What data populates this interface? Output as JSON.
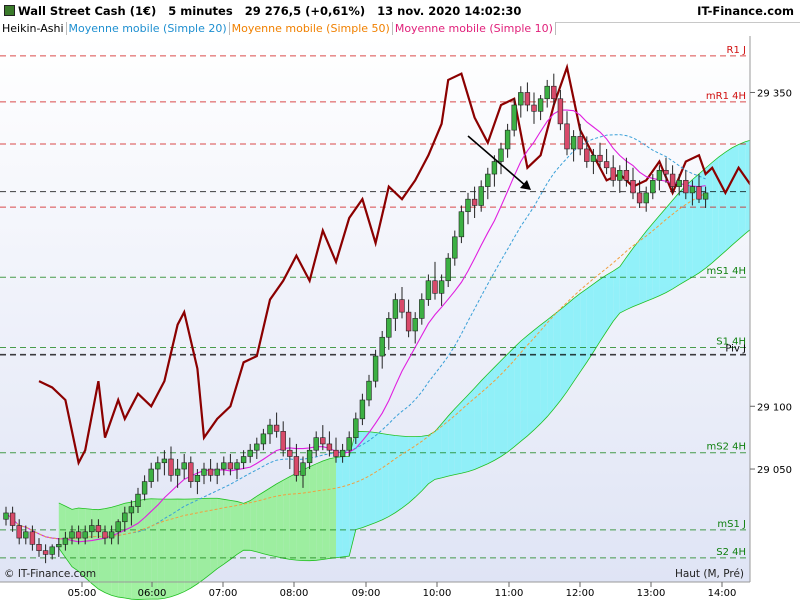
{
  "header": {
    "instrument": "Wall Street Cash (1€)",
    "timeframe": "5 minutes",
    "price": "29 276,5 (+0,61%)",
    "datetime": "13 nov. 2020 14:02:30",
    "brand": "IT-Finance.com"
  },
  "legend": {
    "chart_style": "Heikin-Ashi",
    "ma20": "Moyenne mobile (Simple 20)",
    "ma50": "Moyenne mobile (Simple 50)",
    "ma10": "Moyenne mobile (Simple 10)"
  },
  "footer": {
    "copyright": "© IT-Finance.com",
    "mode": "Haut (M, Pré)"
  },
  "colors": {
    "bull": "#3cb043",
    "bear": "#d84a6a",
    "ma20": "#3aa0d8",
    "ma50": "#f0a040",
    "ma10": "#e020e0",
    "pivot_line": "#8b0000",
    "cloud_bull": "#90ee90",
    "cloud_bear": "#80f0f8",
    "level_red": "#d01010",
    "level_green": "#108010"
  },
  "chart_data": {
    "type": "candlestick",
    "ylim": [
      28960,
      29395
    ],
    "xlim": [
      "04:20",
      "14:25"
    ],
    "x_ticks": [
      "05:00",
      "06:00",
      "07:00",
      "08:00",
      "09:00",
      "10:00",
      "11:00",
      "12:00",
      "13:00",
      "14:00"
    ],
    "y_ticks": [
      29350,
      29100,
      29050
    ],
    "levels": [
      {
        "label": "R1 J",
        "value": 29379.2,
        "value_label": "29 379,2",
        "kind": "resistance"
      },
      {
        "label": "mR1 4H",
        "value": 29342.5,
        "value_label": "29 342,5",
        "kind": "resistance"
      },
      {
        "label": "",
        "value": 29309.0,
        "value_label": "29 309,0",
        "kind": "resistance"
      },
      {
        "label": "",
        "value": 29271.0,
        "value_label": "29 271,0",
        "kind": "last"
      },
      {
        "label": "",
        "value": 29258.7,
        "value_label": "29 258,7",
        "kind": "resistance"
      },
      {
        "label": "mS1 4H",
        "value": 29202.8,
        "value_label": "29 202,8",
        "kind": "support"
      },
      {
        "label": "S1 4H",
        "value": 29146.8,
        "value_label": "29 146,8",
        "kind": "support"
      },
      {
        "label": "Piv J",
        "value": 29141.1,
        "value_label": "29 141,1",
        "kind": "pivot"
      },
      {
        "label": "mS2 4H",
        "value": 29063.0,
        "value_label": "29 063,0",
        "kind": "support"
      },
      {
        "label": "mS1 J",
        "value": 29001.5,
        "value_label": "29 001,5",
        "kind": "support"
      },
      {
        "label": "S2 4H",
        "value": 28979.2,
        "value_label": "28 979,2",
        "kind": "support"
      }
    ],
    "pivot_curve": [
      [
        5,
        29120
      ],
      [
        7,
        29115
      ],
      [
        9,
        29105
      ],
      [
        10,
        29080
      ],
      [
        11,
        29055
      ],
      [
        12,
        29065
      ],
      [
        14,
        29120
      ],
      [
        15,
        29075
      ],
      [
        17,
        29105
      ],
      [
        18,
        29090
      ],
      [
        20,
        29110
      ],
      [
        22,
        29100
      ],
      [
        24,
        29120
      ],
      [
        26,
        29165
      ],
      [
        27,
        29175
      ],
      [
        29,
        29130
      ],
      [
        30,
        29075
      ],
      [
        32,
        29090
      ],
      [
        34,
        29100
      ],
      [
        36,
        29135
      ],
      [
        38,
        29140
      ],
      [
        40,
        29185
      ],
      [
        42,
        29200
      ],
      [
        44,
        29220
      ],
      [
        46,
        29200
      ],
      [
        48,
        29240
      ],
      [
        50,
        29215
      ],
      [
        52,
        29250
      ],
      [
        54,
        29265
      ],
      [
        56,
        29230
      ],
      [
        58,
        29275
      ],
      [
        60,
        29265
      ],
      [
        62,
        29280
      ],
      [
        64,
        29300
      ],
      [
        66,
        29325
      ],
      [
        67,
        29360
      ],
      [
        69,
        29365
      ],
      [
        71,
        29330
      ],
      [
        73,
        29310
      ],
      [
        75,
        29340
      ],
      [
        77,
        29345
      ],
      [
        79,
        29290
      ],
      [
        81,
        29300
      ],
      [
        83,
        29340
      ],
      [
        85,
        29370
      ],
      [
        87,
        29320
      ],
      [
        89,
        29300
      ],
      [
        91,
        29280
      ],
      [
        93,
        29285
      ],
      [
        95,
        29275
      ],
      [
        97,
        29280
      ],
      [
        99,
        29295
      ],
      [
        101,
        29270
      ],
      [
        103,
        29295
      ],
      [
        105,
        29300
      ],
      [
        106,
        29285
      ],
      [
        107,
        29290
      ],
      [
        109,
        29270
      ],
      [
        111,
        29290
      ],
      [
        113,
        29275
      ],
      [
        115,
        29270
      ],
      [
        117,
        29260
      ],
      [
        119,
        29275
      ]
    ],
    "candles": [
      [
        0,
        29010,
        29020,
        29005,
        29015
      ],
      [
        1,
        29015,
        29020,
        29000,
        29005
      ],
      [
        2,
        29005,
        29010,
        28990,
        28995
      ],
      [
        3,
        28995,
        29005,
        28990,
        29000
      ],
      [
        4,
        29000,
        29005,
        28985,
        28990
      ],
      [
        5,
        28990,
        28995,
        28980,
        28985
      ],
      [
        6,
        28985,
        28990,
        28975,
        28982
      ],
      [
        7,
        28982,
        28990,
        28978,
        28988
      ],
      [
        8,
        28988,
        28995,
        28980,
        28990
      ],
      [
        9,
        28990,
        29000,
        28985,
        28995
      ],
      [
        10,
        28995,
        29005,
        28990,
        29000
      ],
      [
        11,
        29000,
        29005,
        28990,
        28995
      ],
      [
        12,
        28995,
        29005,
        28990,
        29000
      ],
      [
        13,
        29000,
        29010,
        28995,
        29005
      ],
      [
        14,
        29005,
        29010,
        28995,
        29000
      ],
      [
        15,
        29000,
        29005,
        28990,
        28995
      ],
      [
        16,
        28995,
        29005,
        28990,
        29000
      ],
      [
        17,
        29000,
        29010,
        28990,
        29008
      ],
      [
        18,
        29008,
        29020,
        29000,
        29015
      ],
      [
        19,
        29015,
        29025,
        29005,
        29020
      ],
      [
        20,
        29020,
        29035,
        29015,
        29030
      ],
      [
        21,
        29030,
        29045,
        29025,
        29040
      ],
      [
        22,
        29040,
        29055,
        29035,
        29050
      ],
      [
        23,
        29050,
        29060,
        29040,
        29055
      ],
      [
        24,
        29055,
        29065,
        29045,
        29058
      ],
      [
        25,
        29058,
        29068,
        29040,
        29045
      ],
      [
        26,
        29045,
        29058,
        29035,
        29050
      ],
      [
        27,
        29050,
        29062,
        29042,
        29055
      ],
      [
        28,
        29055,
        29060,
        29035,
        29040
      ],
      [
        29,
        29040,
        29050,
        29030,
        29045
      ],
      [
        30,
        29045,
        29055,
        29038,
        29050
      ],
      [
        31,
        29050,
        29058,
        29040,
        29045
      ],
      [
        32,
        29045,
        29055,
        29038,
        29050
      ],
      [
        33,
        29050,
        29060,
        29045,
        29055
      ],
      [
        34,
        29055,
        29062,
        29045,
        29050
      ],
      [
        35,
        29050,
        29058,
        29042,
        29055
      ],
      [
        36,
        29055,
        29065,
        29050,
        29060
      ],
      [
        37,
        29060,
        29070,
        29055,
        29065
      ],
      [
        38,
        29065,
        29075,
        29058,
        29070
      ],
      [
        39,
        29070,
        29082,
        29065,
        29078
      ],
      [
        40,
        29078,
        29090,
        29070,
        29085
      ],
      [
        41,
        29085,
        29095,
        29075,
        29080
      ],
      [
        42,
        29080,
        29088,
        29060,
        29065
      ],
      [
        43,
        29065,
        29075,
        29050,
        29060
      ],
      [
        44,
        29060,
        29070,
        29040,
        29045
      ],
      [
        45,
        29045,
        29060,
        29035,
        29055
      ],
      [
        46,
        29055,
        29070,
        29050,
        29065
      ],
      [
        47,
        29065,
        29080,
        29060,
        29075
      ],
      [
        48,
        29075,
        29085,
        29065,
        29070
      ],
      [
        49,
        29070,
        29080,
        29060,
        29065
      ],
      [
        50,
        29065,
        29075,
        29055,
        29060
      ],
      [
        51,
        29060,
        29070,
        29055,
        29065
      ],
      [
        52,
        29065,
        29080,
        29060,
        29075
      ],
      [
        53,
        29075,
        29095,
        29070,
        29090
      ],
      [
        54,
        29090,
        29110,
        29085,
        29105
      ],
      [
        55,
        29105,
        29125,
        29100,
        29120
      ],
      [
        56,
        29120,
        29145,
        29115,
        29140
      ],
      [
        57,
        29140,
        29160,
        29130,
        29155
      ],
      [
        58,
        29155,
        29175,
        29145,
        29170
      ],
      [
        59,
        29170,
        29190,
        29160,
        29185
      ],
      [
        60,
        29185,
        29195,
        29170,
        29175
      ],
      [
        61,
        29175,
        29185,
        29155,
        29160
      ],
      [
        62,
        29160,
        29175,
        29150,
        29170
      ],
      [
        63,
        29170,
        29190,
        29165,
        29185
      ],
      [
        64,
        29185,
        29205,
        29180,
        29200
      ],
      [
        65,
        29200,
        29215,
        29185,
        29190
      ],
      [
        66,
        29190,
        29205,
        29180,
        29200
      ],
      [
        67,
        29200,
        29222,
        29195,
        29218
      ],
      [
        68,
        29218,
        29240,
        29212,
        29235
      ],
      [
        69,
        29235,
        29260,
        29230,
        29255
      ],
      [
        70,
        29255,
        29270,
        29245,
        29265
      ],
      [
        71,
        29265,
        29275,
        29250,
        29260
      ],
      [
        72,
        29260,
        29280,
        29255,
        29275
      ],
      [
        73,
        29275,
        29290,
        29265,
        29285
      ],
      [
        74,
        29285,
        29300,
        29275,
        29295
      ],
      [
        75,
        29295,
        29310,
        29285,
        29305
      ],
      [
        76,
        29305,
        29325,
        29298,
        29320
      ],
      [
        77,
        29320,
        29345,
        29315,
        29340
      ],
      [
        78,
        29340,
        29355,
        29330,
        29350
      ],
      [
        79,
        29350,
        29358,
        29335,
        29340
      ],
      [
        80,
        29340,
        29350,
        29325,
        29335
      ],
      [
        81,
        29335,
        29348,
        29328,
        29345
      ],
      [
        82,
        29345,
        29360,
        29338,
        29355
      ],
      [
        83,
        29355,
        29365,
        29340,
        29345
      ],
      [
        84,
        29345,
        29352,
        29320,
        29325
      ],
      [
        85,
        29325,
        29335,
        29300,
        29305
      ],
      [
        86,
        29305,
        29320,
        29295,
        29315
      ],
      [
        87,
        29315,
        29325,
        29300,
        29305
      ],
      [
        88,
        29305,
        29315,
        29290,
        29295
      ],
      [
        89,
        29295,
        29305,
        29285,
        29300
      ],
      [
        90,
        29300,
        29310,
        29290,
        29295
      ],
      [
        91,
        29295,
        29305,
        29285,
        29290
      ],
      [
        92,
        29290,
        29300,
        29275,
        29280
      ],
      [
        93,
        29280,
        29292,
        29270,
        29288
      ],
      [
        94,
        29288,
        29298,
        29275,
        29280
      ],
      [
        95,
        29280,
        29290,
        29265,
        29270
      ],
      [
        96,
        29270,
        29280,
        29258,
        29262
      ],
      [
        97,
        29262,
        29275,
        29255,
        29270
      ],
      [
        98,
        29270,
        29285,
        29265,
        29280
      ],
      [
        99,
        29280,
        29292,
        29272,
        29288
      ],
      [
        100,
        29288,
        29298,
        29278,
        29285
      ],
      [
        101,
        29285,
        29292,
        29270,
        29275
      ],
      [
        102,
        29275,
        29285,
        29268,
        29280
      ],
      [
        103,
        29280,
        29288,
        29265,
        29270
      ],
      [
        104,
        29270,
        29280,
        29260,
        29275
      ],
      [
        105,
        29275,
        29285,
        29262,
        29265
      ],
      [
        106,
        29265,
        29275,
        29258,
        29270
      ]
    ]
  }
}
